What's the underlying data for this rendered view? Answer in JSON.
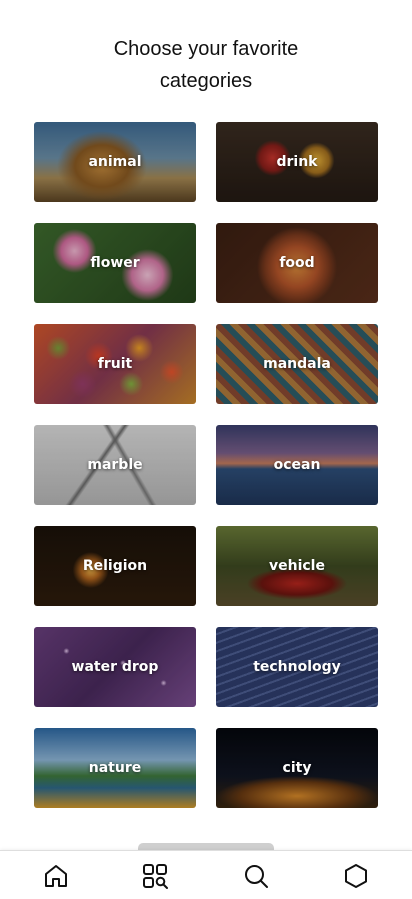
{
  "page": {
    "title_line1": "Choose your favorite",
    "title_line2": "categories"
  },
  "categories": [
    {
      "label": "animal",
      "icon": "lion-photo"
    },
    {
      "label": "drink",
      "icon": "drinks-photo"
    },
    {
      "label": "flower",
      "icon": "flowers-photo"
    },
    {
      "label": "food",
      "icon": "pizza-photo"
    },
    {
      "label": "fruit",
      "icon": "fruits-photo"
    },
    {
      "label": "mandala",
      "icon": "mandala-pattern-photo"
    },
    {
      "label": "marble",
      "icon": "marble-texture-photo"
    },
    {
      "label": "ocean",
      "icon": "ocean-sunset-photo"
    },
    {
      "label": "Religion",
      "icon": "lantern-photo"
    },
    {
      "label": "vehicle",
      "icon": "red-car-photo"
    },
    {
      "label": "water drop",
      "icon": "water-drops-photo"
    },
    {
      "label": "technology",
      "icon": "keyboard-photo"
    },
    {
      "label": "nature",
      "icon": "lake-flowers-photo"
    },
    {
      "label": "city",
      "icon": "city-night-photo"
    }
  ],
  "bottom_nav": [
    {
      "icon": "home-icon"
    },
    {
      "icon": "categories-search-icon"
    },
    {
      "icon": "search-icon"
    },
    {
      "icon": "hexagon-icon"
    }
  ]
}
